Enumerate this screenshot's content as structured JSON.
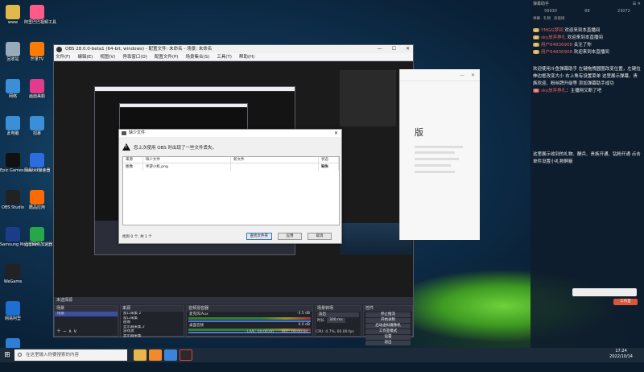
{
  "desktop": {
    "icons_col1": [
      {
        "label": "www",
        "icon": "folder-icon",
        "color": "#e2b84d"
      },
      {
        "label": "回收站",
        "icon": "recycle-bin-icon",
        "color": "#9ab"
      },
      {
        "label": "网络",
        "icon": "network-icon",
        "color": "#3a8fd8"
      },
      {
        "label": "此电脑",
        "icon": "computer-icon",
        "color": "#3a8fd8"
      },
      {
        "label": "Epic Games Launcher",
        "icon": "epic-icon",
        "color": "#111"
      },
      {
        "label": "OBS Studio",
        "icon": "obs-icon",
        "color": "#222"
      },
      {
        "label": "Samsung Magician",
        "icon": "samsung-icon",
        "color": "#1c3c8a"
      },
      {
        "label": "WeGame",
        "icon": "wegame-icon",
        "color": "#222"
      },
      {
        "label": "网易阿里",
        "icon": "browser-icon",
        "color": "#1f6ed4"
      },
      {
        "label": "桌面应用",
        "icon": "app-icon",
        "color": "#2d7fd6"
      }
    ],
    "icons_col2": [
      {
        "label": "阿里巴巴视频工具",
        "icon": "video-tool-icon",
        "color": "#ff5a8a"
      },
      {
        "label": "芒果TV",
        "icon": "mango-tv-icon",
        "color": "#ff7a00"
      },
      {
        "label": "画面美颜",
        "icon": "beauty-icon",
        "color": "#e23a8c"
      },
      {
        "label": "招募",
        "icon": "recruit-icon",
        "color": "#3a8fd8"
      },
      {
        "label": "网易UU加速器",
        "icon": "uu-accelerator-icon",
        "color": "#2d6be0"
      },
      {
        "label": "酷品应用",
        "icon": "app-store-icon",
        "color": "#ff6a00"
      },
      {
        "label": "迅雷网络加速器",
        "icon": "accelerator-icon",
        "color": "#27a848"
      }
    ]
  },
  "obs": {
    "title": "OBS 28.0.0-beta1 (64-bit, windows) - 配置文件: 未命名 - 场景: 未命名",
    "menu": [
      "文件(F)",
      "编辑(E)",
      "视图(V)",
      "停靠窗口(D)",
      "配置文件(P)",
      "场景集合(S)",
      "工具(T)",
      "帮助(H)"
    ],
    "scene_label": "未选择源",
    "docks": {
      "scenes": {
        "title": "场景",
        "items": [
          "场景"
        ]
      },
      "sources": {
        "title": "来源",
        "items": [
          "窗口采集 2",
          "窗口采集",
          "图像",
          "显示器采集 2",
          "游戏源",
          "显示器采集"
        ]
      },
      "mixer": {
        "title": "音频混音器",
        "channels": [
          {
            "name": "麦克风/Aux",
            "db": "-3.5 dB"
          },
          {
            "name": "桌面音频",
            "db": "0.0 dB"
          }
        ]
      },
      "transitions": {
        "title": "场景转场",
        "type": "淡出",
        "duration_label": "时长",
        "duration": "300 ms"
      },
      "controls": {
        "title": "控件",
        "buttons": [
          "停止推流",
          "开始录制",
          "启动虚拟摄像机",
          "工作室模式",
          "设置",
          "退出"
        ]
      }
    },
    "status": {
      "live": "LIVE: 00:00:00",
      "rec": "REC: 00:00:00",
      "cpu": "CPU: 4.7%, 60.00 fps"
    }
  },
  "missing_files": {
    "title": "缺少文件",
    "message": "您上次使用 OBS 时出现了一些文件丢失。",
    "columns": [
      "来源",
      "缺少文件",
      "新文件",
      "状态"
    ],
    "rows": [
      {
        "source": "图像",
        "file": "手游小机.png",
        "new_file": "",
        "status": "缺失"
      }
    ],
    "footer": "找到 0 个, 共 1 个",
    "buttons": {
      "search": "查找文件夹",
      "apply": "应用",
      "cancel": "取消"
    }
  },
  "app_window": {
    "title_text": "版"
  },
  "chat": {
    "top_left": "弹幕助手",
    "stats": [
      "56930",
      "68",
      "23072"
    ],
    "tabs": [
      "弹幕",
      "礼物",
      "高能榜"
    ],
    "messages": [
      {
        "user": "YMGG梦回",
        "text": "欢迎来到本直播间"
      },
      {
        "user": "sky放弃挣扎",
        "text": "欢迎来到本直播间"
      },
      {
        "user": "用户64836908",
        "text": "关注了你"
      },
      {
        "user": "用户64836908",
        "text": "欢迎来到本直播间"
      }
    ],
    "system1": "欢迎使用斗鱼弹幕助手 左键拖拽圆圈改变位置，左键拉伸边框改变大小 右上角有设置菜单 这里展示弹幕、贵族欢迎、粉丝牌升级等 添加弹幕助手成功",
    "highlight_user": "sky放弃挣扎",
    "highlight_text": "主播网又断了吧",
    "system2": "这里展示收到的礼物、酬兵、贵族开通、钻粉开通 点击单件设置小礼物屏蔽",
    "send_button": "工作室"
  },
  "taskbar": {
    "search_placeholder": "在这里输入你要搜索的内容",
    "time": "17:24",
    "date": "2022/10/14"
  }
}
